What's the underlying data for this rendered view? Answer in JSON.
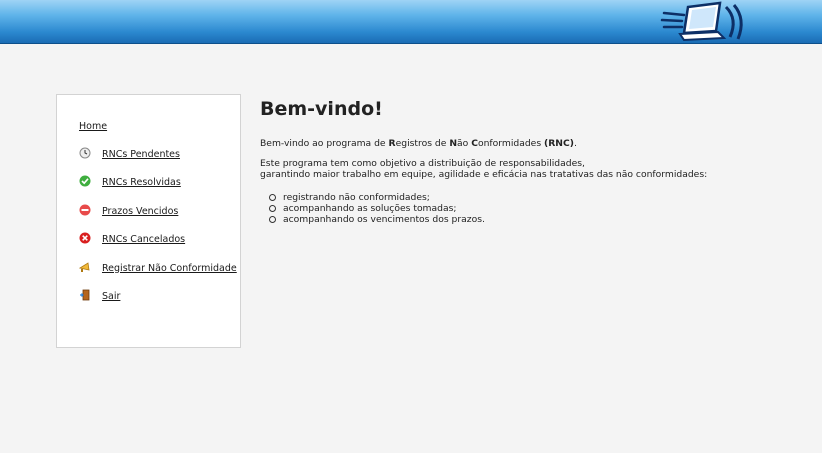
{
  "header": {
    "logo_icon": "laptop-logo-icon"
  },
  "sidebar": {
    "items": [
      {
        "label": "Home",
        "icon": ""
      },
      {
        "label": "RNCs Pendentes",
        "icon": "clock-icon"
      },
      {
        "label": "RNCs Resolvidas",
        "icon": "check-icon"
      },
      {
        "label": "Prazos Vencidos",
        "icon": "no-entry-icon"
      },
      {
        "label": "RNCs Cancelados",
        "icon": "cancel-icon"
      },
      {
        "label": "Registrar Não Conformidade",
        "icon": "megaphone-icon"
      },
      {
        "label": "Sair",
        "icon": "exit-door-icon"
      }
    ]
  },
  "main": {
    "title": "Bem-vindo!",
    "intro": {
      "t1": "Bem-vindo ao programa de ",
      "r": "R",
      "t2": "egistros de ",
      "n": "N",
      "t3": "ão ",
      "c": "C",
      "t4": "onformidades ",
      "rnc": "(RNC)",
      "t5": "."
    },
    "description_line1": "Este programa tem como objetivo a distribuição de responsabilidades,",
    "description_line2": "garantindo maior trabalho em equipe, agilidade e eficácia nas tratativas das não conformidades:",
    "list": [
      "registrando não conformidades;",
      "acompanhando as soluções tomadas;",
      "acompanhando os vencimentos dos prazos."
    ]
  }
}
